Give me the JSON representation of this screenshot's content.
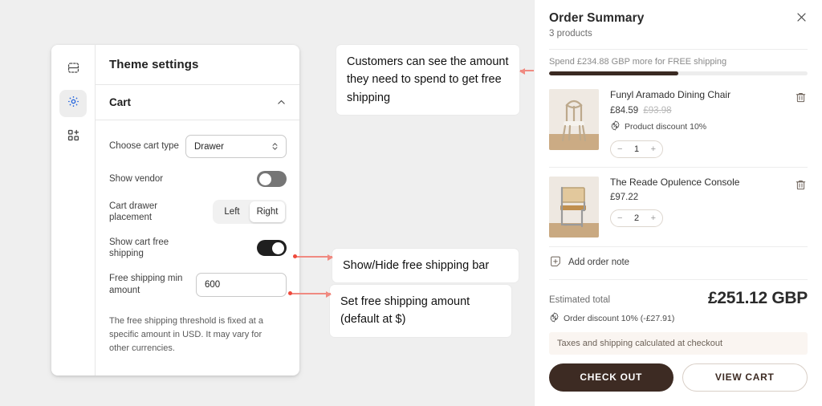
{
  "editor": {
    "rail": [
      {
        "name": "sections-icon",
        "label": "Sections"
      },
      {
        "name": "theme-settings-icon",
        "label": "Theme settings"
      },
      {
        "name": "apps-icon",
        "label": "Apps"
      }
    ],
    "panel_title": "Theme settings",
    "section": {
      "title": "Cart",
      "collapse_icon": "chevron-up-icon"
    },
    "fields": {
      "cart_type": {
        "label": "Choose cart type",
        "value": "Drawer"
      },
      "show_vendor": {
        "label": "Show vendor",
        "state": "off"
      },
      "drawer_placement": {
        "label": "Cart drawer placement",
        "options": [
          "Left",
          "Right"
        ],
        "selected": "Right"
      },
      "show_free_shipping": {
        "label": "Show cart free shipping",
        "state": "on"
      },
      "free_shipping_min": {
        "label": "Free shipping min amount",
        "value": "600",
        "placeholder": "600"
      }
    },
    "helper_text": "The free shipping threshold is fixed at a specific amount in USD. It may vary for other currencies."
  },
  "callouts": {
    "shipping_info": "Customers can see the amount they need to spend to get free shipping",
    "toggle_bar": "Show/Hide free shipping bar",
    "amount": "Set free shipping amount (default at $)"
  },
  "drawer": {
    "title": "Order Summary",
    "subtitle": "3 products",
    "close_icon": "close-icon",
    "free_shipping": {
      "message": "Spend £234.88 GBP more for FREE shipping",
      "progress_percent": 50
    },
    "items": [
      {
        "name": "Funyl Aramado Dining Chair",
        "price": "£84.59",
        "compare_at_price": "£93.98",
        "discount": "Product discount 10%",
        "discount_icon": "discount-tag-icon",
        "quantity": "1",
        "decrease_label": "−",
        "increase_label": "+",
        "remove_icon": "trash-icon",
        "image_alt": "Wooden bentwood dining chair"
      },
      {
        "name": "The Reade Opulence Console",
        "price": "£97.22",
        "compare_at_price": "",
        "discount": "",
        "discount_icon": "",
        "quantity": "2",
        "decrease_label": "−",
        "increase_label": "+",
        "remove_icon": "trash-icon",
        "image_alt": "Cane back cantilever chair"
      }
    ],
    "add_note": {
      "label": "Add order note",
      "icon": "note-plus-icon"
    },
    "totals": {
      "label": "Estimated total",
      "value": "£251.12 GBP",
      "order_discount": "Order discount 10% (-£27.91)",
      "order_discount_icon": "discount-tag-icon",
      "tax_note": "Taxes and shipping calculated at checkout"
    },
    "actions": {
      "checkout": "CHECK OUT",
      "view_cart": "VIEW CART"
    }
  },
  "colors": {
    "accent_blue": "#2d6bdf",
    "checkout_brown": "#3d2b23",
    "progress_fill": "#3a2a22",
    "arrow_red": "#f08a81",
    "toggle_on": "#1f1f1f",
    "toggle_off": "#767676"
  }
}
